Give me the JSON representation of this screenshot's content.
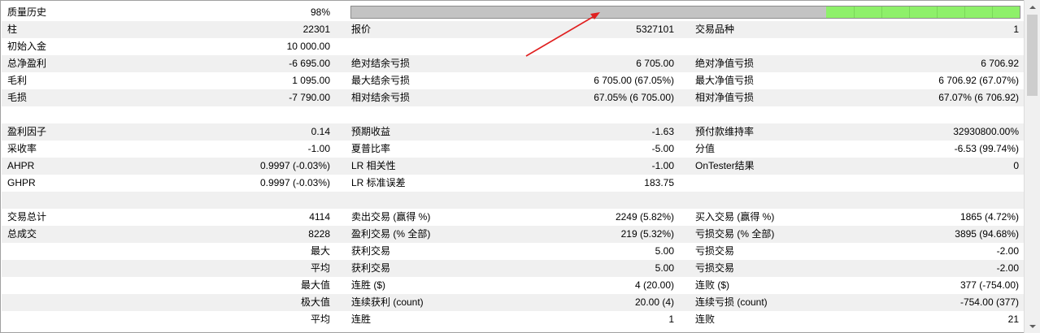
{
  "quality": {
    "label": "质量历史",
    "value": "98%",
    "fraction": 0.98
  },
  "rows": [
    {
      "c2l": "报价",
      "c2v": "5327101",
      "c3l": "交易品种",
      "c3v": "1",
      "c1l": "柱",
      "c1v": "22301"
    },
    {
      "c1l": "初始入金",
      "c1v": "10 000.00"
    },
    {
      "c1l": "总净盈利",
      "c1v": "-6 695.00",
      "c2l": "绝对结余亏损",
      "c2v": "6 705.00",
      "c3l": "绝对净值亏损",
      "c3v": "6 706.92"
    },
    {
      "c1l": "毛利",
      "c1v": "1 095.00",
      "c2l": "最大结余亏损",
      "c2v": "6 705.00 (67.05%)",
      "c3l": "最大净值亏损",
      "c3v": "6 706.92 (67.07%)"
    },
    {
      "c1l": "毛损",
      "c1v": "-7 790.00",
      "c2l": "相对结余亏损",
      "c2v": "67.05% (6 705.00)",
      "c3l": "相对净值亏损",
      "c3v": "67.07% (6 706.92)"
    },
    {},
    {
      "c1l": "盈利因子",
      "c1v": "0.14",
      "c2l": "预期收益",
      "c2v": "-1.63",
      "c3l": "预付款维持率",
      "c3v": "32930800.00%"
    },
    {
      "c1l": "采收率",
      "c1v": "-1.00",
      "c2l": "夏普比率",
      "c2v": "-5.00",
      "c3l": "分值",
      "c3v": "-6.53 (99.74%)"
    },
    {
      "c1l": "AHPR",
      "c1v": "0.9997 (-0.03%)",
      "c2l": "LR 相关性",
      "c2v": "-1.00",
      "c3l": "OnTester结果",
      "c3v": "0"
    },
    {
      "c1l": "GHPR",
      "c1v": "0.9997 (-0.03%)",
      "c2l": "LR 标准误差",
      "c2v": "183.75"
    },
    {},
    {
      "c1l": "交易总计",
      "c1v": "4114",
      "c2l": "卖出交易 (赢得 %)",
      "c2v": "2249 (5.82%)",
      "c3l": "买入交易 (赢得 %)",
      "c3v": "1865 (4.72%)"
    },
    {
      "c1l": "总成交",
      "c1v": "8228",
      "c2l": "盈利交易 (% 全部)",
      "c2v": "219 (5.32%)",
      "c3l": "亏损交易 (% 全部)",
      "c3v": "3895 (94.68%)"
    },
    {
      "c1v": "最大",
      "c2l": "获利交易",
      "c2v": "5.00",
      "c3l": "亏损交易",
      "c3v": "-2.00"
    },
    {
      "c1v": "平均",
      "c2l": "获利交易",
      "c2v": "5.00",
      "c3l": "亏损交易",
      "c3v": "-2.00"
    },
    {
      "c1v": "最大值",
      "c2l": "连胜 ($)",
      "c2v": "4 (20.00)",
      "c3l": "连败 ($)",
      "c3v": "377 (-754.00)"
    },
    {
      "c1v": "极大值",
      "c2l": "连续获利 (count)",
      "c2v": "20.00 (4)",
      "c3l": "连续亏损 (count)",
      "c3v": "-754.00 (377)"
    },
    {
      "c1v": "平均",
      "c2l": "连胜",
      "c2v": "1",
      "c3l": "连败",
      "c3v": "21"
    }
  ],
  "colors": {
    "shade": "#f0f0f0",
    "bar_gray": "#c3c3c3",
    "bar_green": "#8ef06a",
    "arrow": "#e02020"
  }
}
